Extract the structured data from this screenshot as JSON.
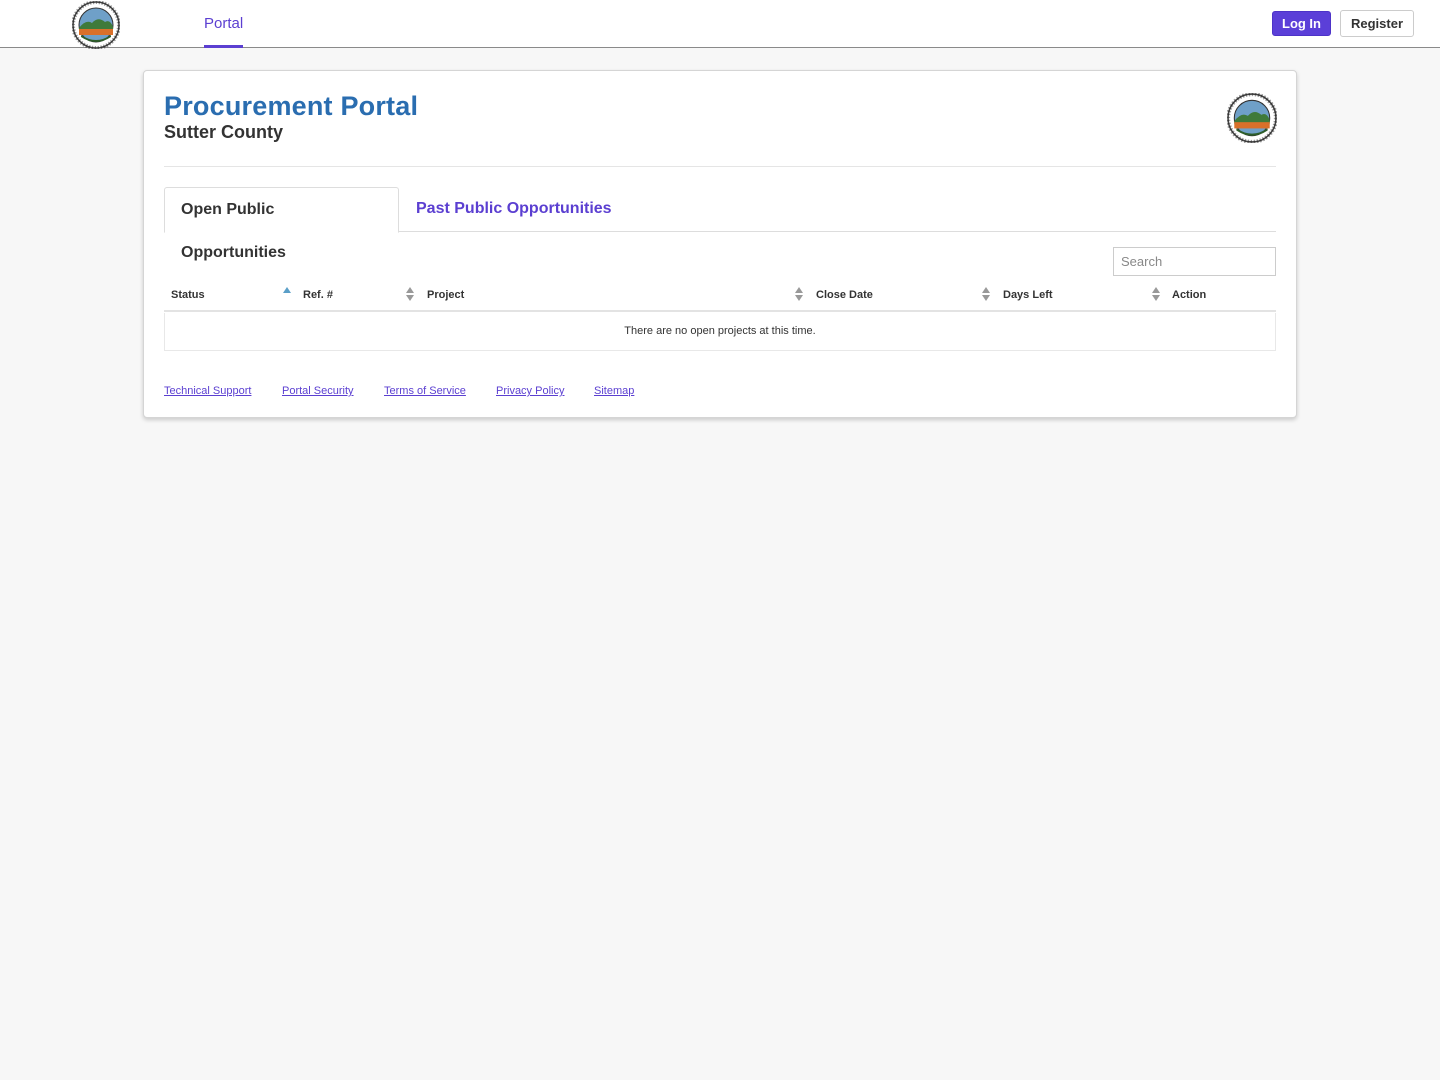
{
  "nav": {
    "logo_icon": "sutter-county-seal-icon",
    "portal_label": "Portal",
    "login_label": "Log In",
    "register_label": "Register"
  },
  "header": {
    "title": "Procurement Portal",
    "subtitle": "Sutter County",
    "seal_icon": "sutter-county-seal-icon"
  },
  "tabs": [
    {
      "label": "Open Public Opportunities",
      "active": true
    },
    {
      "label": "Past Public Opportunities",
      "active": false
    }
  ],
  "search": {
    "placeholder": "Search",
    "value": ""
  },
  "table": {
    "columns": [
      {
        "label": "Status",
        "sort": "ascending"
      },
      {
        "label": "Ref. #",
        "sort": "both"
      },
      {
        "label": "Project",
        "sort": "both"
      },
      {
        "label": "Close Date",
        "sort": "both"
      },
      {
        "label": "Days Left",
        "sort": "both"
      },
      {
        "label": "Action",
        "sort": "none"
      }
    ],
    "empty_message": "There are no open projects at this time."
  },
  "footer": {
    "links": [
      "Technical Support",
      "Portal Security",
      "Terms of Service",
      "Privacy Policy",
      "Sitemap"
    ]
  },
  "colors": {
    "accent": "#5b3fd1",
    "title_blue": "#2a6db0",
    "page_background": "#f7f7f7"
  }
}
